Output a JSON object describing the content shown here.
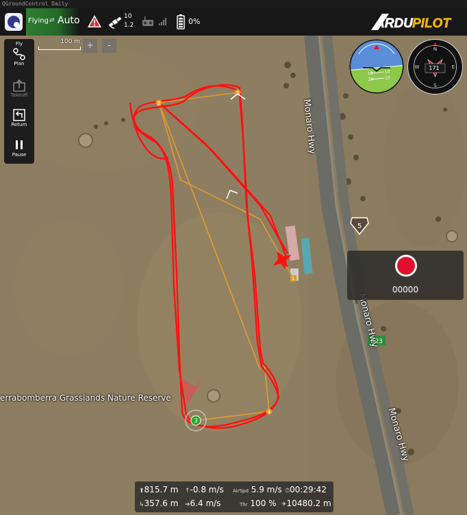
{
  "window": {
    "title": "QGroundControl Daily"
  },
  "toolbar": {
    "flight_state": "Flying",
    "flight_mode": "Auto",
    "gps_count": "10",
    "gps_hdop": "1.2",
    "battery": "0%",
    "brand": "ARDUPILOT"
  },
  "leftbar": [
    {
      "label": "Fly",
      "enabled": true
    },
    {
      "label": "Plan",
      "enabled": true
    },
    {
      "label": "Takeoff",
      "enabled": false
    },
    {
      "label": "Return",
      "enabled": true
    },
    {
      "label": "Pause",
      "enabled": true
    }
  ],
  "map": {
    "scale_label": "100 m",
    "zoom_in": "+",
    "zoom_out": "-",
    "labels": {
      "road_top": "Monaro Hwy",
      "road_mid": "Monaro Hwy",
      "road_bottom": "Monaro Hwy",
      "reserve": "errabomberra Grasslands Nature Reserve",
      "shield_5": "5",
      "shield_b23": "B23"
    },
    "waypoints": [
      "2",
      "7",
      "3",
      "4",
      "1"
    ]
  },
  "instruments": {
    "heading": "171",
    "attitude_scale": [
      "10",
      "10",
      "20",
      "20"
    ],
    "compass_letters": [
      "N",
      "E",
      "S",
      "W"
    ]
  },
  "recorder": {
    "time": "00000"
  },
  "telemetry": {
    "altitude": "815.7 m",
    "climb": "-0.8 m/s",
    "airspeed_label": "AirSpd",
    "airspeed": "5.9 m/s",
    "flight_time": "00:29:42",
    "distance_home": "357.6 m",
    "groundspeed": "6.4 m/s",
    "throttle_label": "Thr",
    "throttle": "100 %",
    "distance_total": "10480.2 m"
  },
  "colors": {
    "toolbar_bg": "#171717",
    "flying_green": "#2e7d32",
    "track_red": "#ff1010",
    "mission_orange": "#e39b2d",
    "record_red": "#e0102a"
  }
}
